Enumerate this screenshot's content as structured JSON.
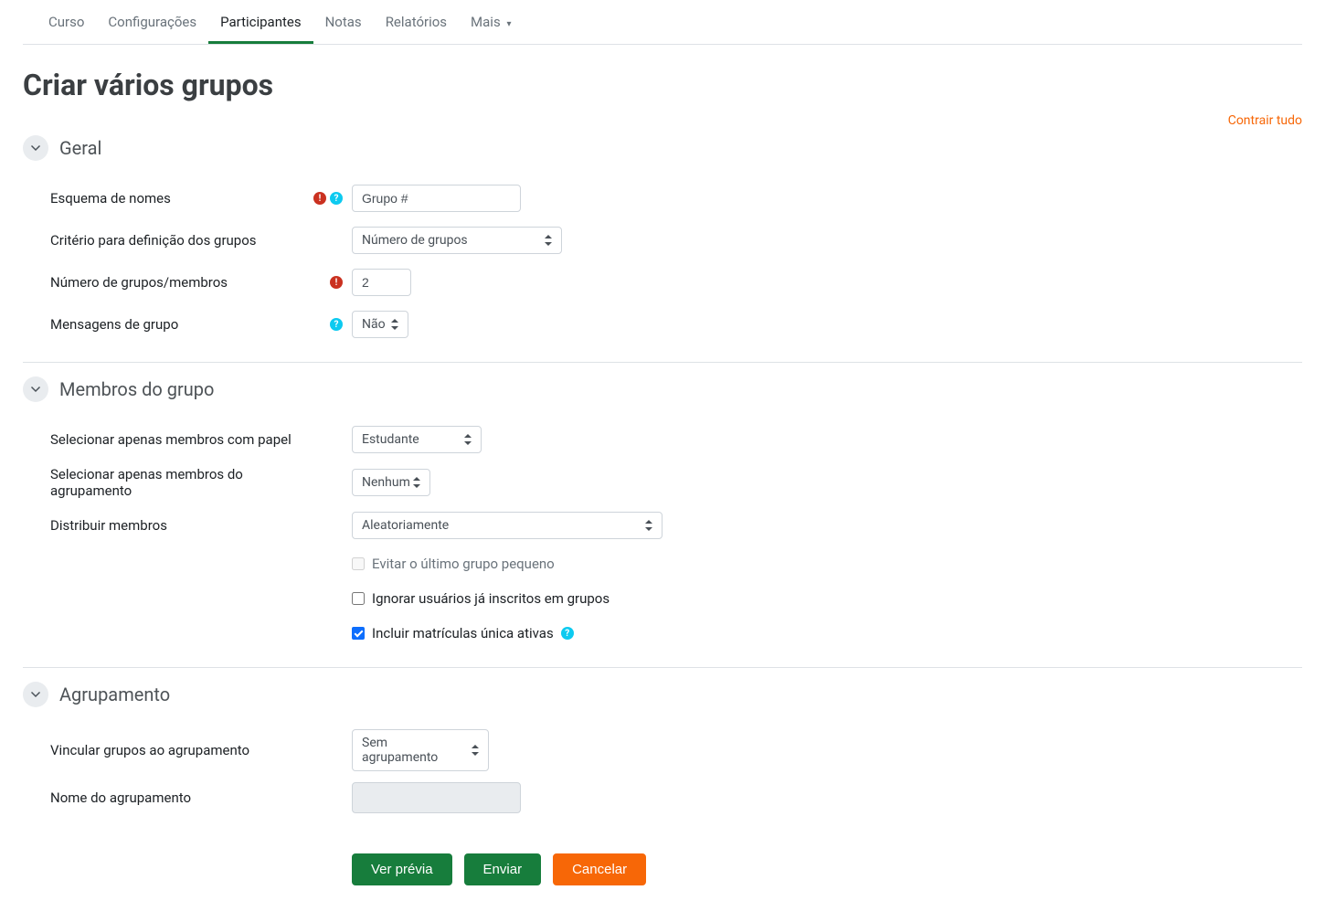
{
  "nav": {
    "tabs": [
      {
        "label": "Curso"
      },
      {
        "label": "Configurações"
      },
      {
        "label": "Participantes",
        "active": true
      },
      {
        "label": "Notas"
      },
      {
        "label": "Relatórios"
      },
      {
        "label": "Mais",
        "dropdown": true
      }
    ]
  },
  "page": {
    "title": "Criar vários grupos",
    "collapse_all": "Contrair tudo"
  },
  "section_general": {
    "title": "Geral",
    "fields": {
      "naming_scheme": {
        "label": "Esquema de nomes",
        "value": "Grupo #"
      },
      "group_criteria": {
        "label": "Critério para definição dos grupos",
        "value": "Número de grupos"
      },
      "group_count": {
        "label": "Número de grupos/membros",
        "value": "2"
      },
      "group_messages": {
        "label": "Mensagens de grupo",
        "value": "Não"
      }
    }
  },
  "section_members": {
    "title": "Membros do grupo",
    "fields": {
      "select_role": {
        "label": "Selecionar apenas membros com papel",
        "value": "Estudante"
      },
      "select_grouping": {
        "label": "Selecionar apenas membros do agrupamento",
        "value": "Nenhum"
      },
      "distribute": {
        "label": "Distribuir membros",
        "value": "Aleatoriamente"
      }
    },
    "checkboxes": {
      "prevent_small": {
        "label": "Evitar o último grupo pequeno",
        "checked": false,
        "disabled": true
      },
      "ignore_existing": {
        "label": "Ignorar usuários já inscritos em grupos",
        "checked": false
      },
      "include_active": {
        "label": "Incluir matrículas única ativas",
        "checked": true
      }
    }
  },
  "section_grouping": {
    "title": "Agrupamento",
    "fields": {
      "link_groups": {
        "label": "Vincular grupos ao agrupamento",
        "value": "Sem agrupamento"
      },
      "grouping_name": {
        "label": "Nome do agrupamento",
        "value": ""
      }
    }
  },
  "actions": {
    "preview": "Ver prévia",
    "submit": "Enviar",
    "cancel": "Cancelar"
  }
}
